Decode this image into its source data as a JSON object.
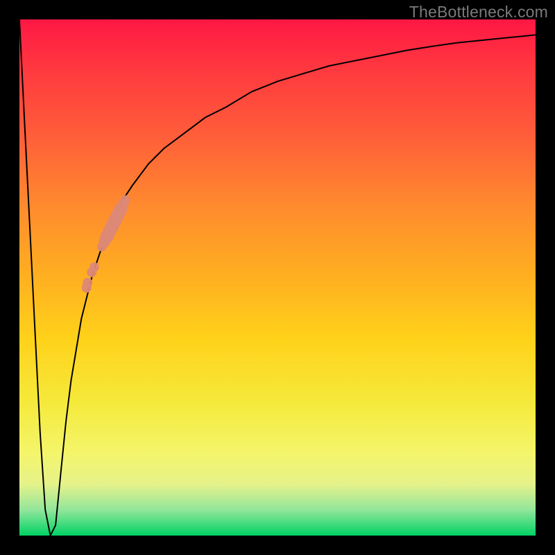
{
  "watermark": "TheBottleneck.com",
  "colors": {
    "frame": "#000000",
    "curve": "#000000",
    "markers": "#dd8876",
    "gradient_stops": [
      "#ff1744",
      "#ff3a3f",
      "#ff5c3a",
      "#ff8a2e",
      "#ffb020",
      "#ffd21a",
      "#f5e93a",
      "#f4f56a",
      "#e6f28a",
      "#93e69b",
      "#00d264"
    ]
  },
  "chart_data": {
    "type": "line",
    "title": "",
    "xlabel": "",
    "ylabel": "",
    "xlim": [
      0,
      100
    ],
    "ylim": [
      0,
      100
    ],
    "x": [
      0,
      1,
      2,
      3,
      4,
      5,
      6,
      7,
      8,
      9,
      10,
      12,
      14,
      16,
      18,
      20,
      22,
      25,
      28,
      32,
      36,
      40,
      45,
      50,
      55,
      60,
      65,
      70,
      75,
      80,
      85,
      90,
      95,
      100
    ],
    "y": [
      100,
      80,
      60,
      40,
      20,
      5,
      0,
      2,
      12,
      22,
      30,
      42,
      50,
      56,
      61,
      65,
      68,
      72,
      75,
      78,
      81,
      83,
      86,
      88,
      89.5,
      91,
      92,
      93,
      94,
      94.8,
      95.5,
      96,
      96.5,
      97
    ],
    "markers": [
      {
        "x": 16,
        "y": 56,
        "r": 1.0
      },
      {
        "x": 16.5,
        "y": 57,
        "r": 1.2
      },
      {
        "x": 17,
        "y": 58,
        "r": 1.4
      },
      {
        "x": 17.5,
        "y": 59,
        "r": 1.4
      },
      {
        "x": 18,
        "y": 60,
        "r": 1.4
      },
      {
        "x": 18.5,
        "y": 61,
        "r": 1.4
      },
      {
        "x": 19,
        "y": 62,
        "r": 1.4
      },
      {
        "x": 19.5,
        "y": 63,
        "r": 1.4
      },
      {
        "x": 20,
        "y": 64,
        "r": 1.2
      },
      {
        "x": 20.5,
        "y": 65,
        "r": 1.0
      },
      {
        "x": 14,
        "y": 51,
        "r": 1.0
      },
      {
        "x": 14.5,
        "y": 52,
        "r": 1.0
      },
      {
        "x": 13,
        "y": 48,
        "r": 1.0
      },
      {
        "x": 13.2,
        "y": 49,
        "r": 1.0
      }
    ]
  }
}
